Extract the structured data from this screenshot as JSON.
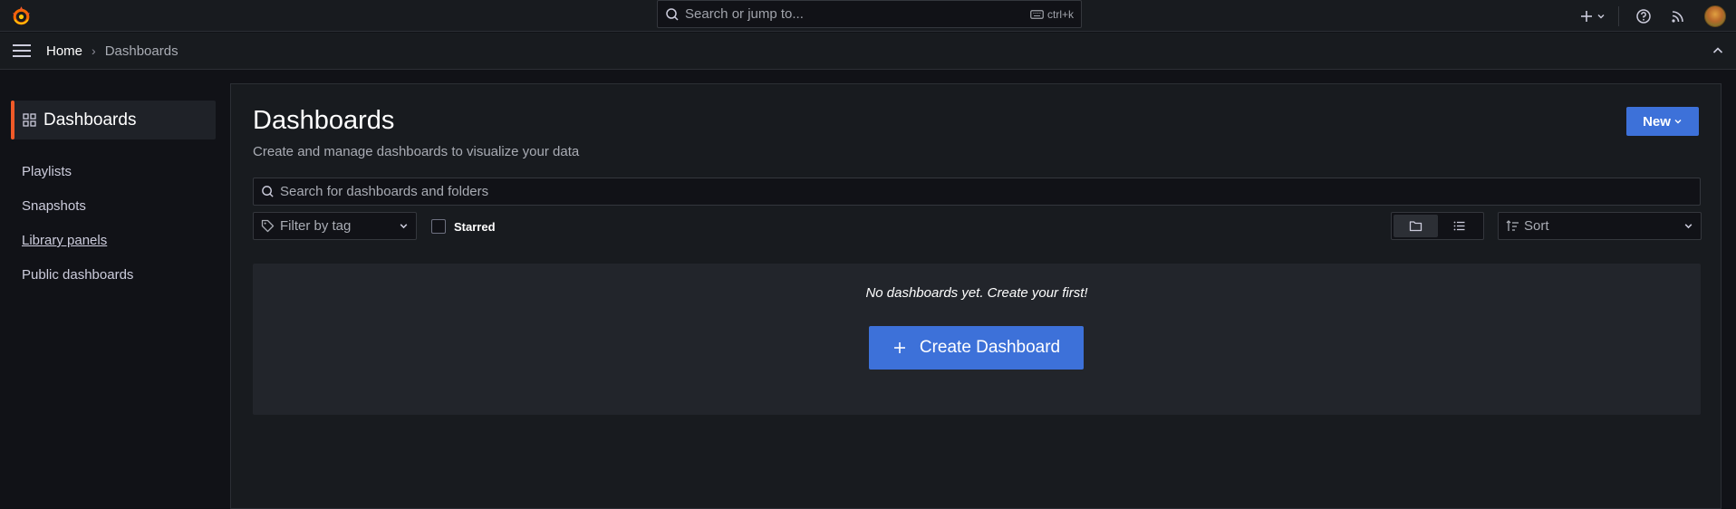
{
  "topbar": {
    "search_placeholder": "Search or jump to...",
    "shortcut": "ctrl+k",
    "icons": [
      "grafana-logo-icon",
      "search-icon",
      "keyboard-icon",
      "plus-icon",
      "help-icon",
      "news-feed-icon",
      "user-avatar"
    ]
  },
  "breadcrumb": {
    "home": "Home",
    "separator": "›",
    "current": "Dashboards"
  },
  "sidebar": {
    "active": "Dashboards",
    "items": [
      {
        "label": "Playlists"
      },
      {
        "label": "Snapshots"
      },
      {
        "label": "Library panels"
      },
      {
        "label": "Public dashboards"
      }
    ]
  },
  "main": {
    "title": "Dashboards",
    "subtitle": "Create and manage dashboards to visualize your data",
    "new_button": "New",
    "search_placeholder": "Search for dashboards and folders",
    "tag_filter_placeholder": "Filter by tag",
    "starred_label": "Starred",
    "starred_checked": false,
    "view_mode": "folders",
    "sort_placeholder": "Sort",
    "empty_message": "No dashboards yet. Create your first!",
    "create_button": "Create Dashboard"
  },
  "colors": {
    "background": "#111217",
    "panel": "#181b1f",
    "primary": "#3d71d9",
    "accent": "#f05a28"
  }
}
